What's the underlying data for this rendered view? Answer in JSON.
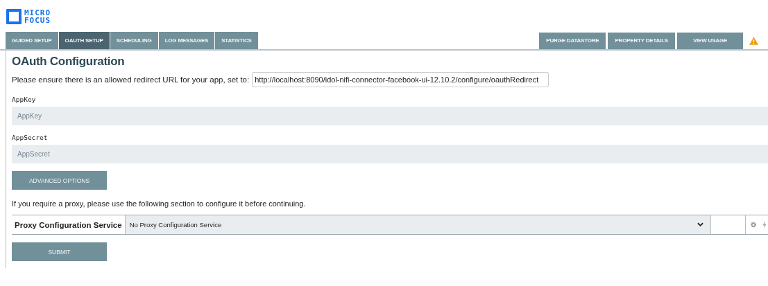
{
  "logo": {
    "line_1": "MICRO",
    "line_2": "FOCUS"
  },
  "tabs": [
    {
      "label": "GUIDED SETUP",
      "selected": false
    },
    {
      "label": "OAUTH SETUP",
      "selected": true
    },
    {
      "label": "SCHEDULING",
      "selected": false
    },
    {
      "label": "LOG MESSAGES",
      "selected": false
    },
    {
      "label": "STATISTICS",
      "selected": false
    }
  ],
  "actions": [
    "PURGE DATASTORE",
    "PROPERTY DETAILS",
    "VIEW USAGE"
  ],
  "heading": "OAuth Configuration",
  "redirect": {
    "text": "Please ensure there is an allowed redirect URL for your app, set to:",
    "value": "http://localhost:8090/idol-nifi-connector-facebook-ui-12.10.2/configure/oauthRedirect"
  },
  "fields": [
    {
      "label": "AppKey",
      "placeholder": "AppKey"
    },
    {
      "label": "AppSecret",
      "placeholder": "AppSecret"
    }
  ],
  "advanced_button": "ADVANCED OPTIONS",
  "proxy_note": "If you require a proxy, please use the following section to configure it before continuing.",
  "proxy": {
    "label": "Proxy Configuration Service",
    "value": "No Proxy Configuration Service"
  },
  "submit_button": "SUBMIT"
}
